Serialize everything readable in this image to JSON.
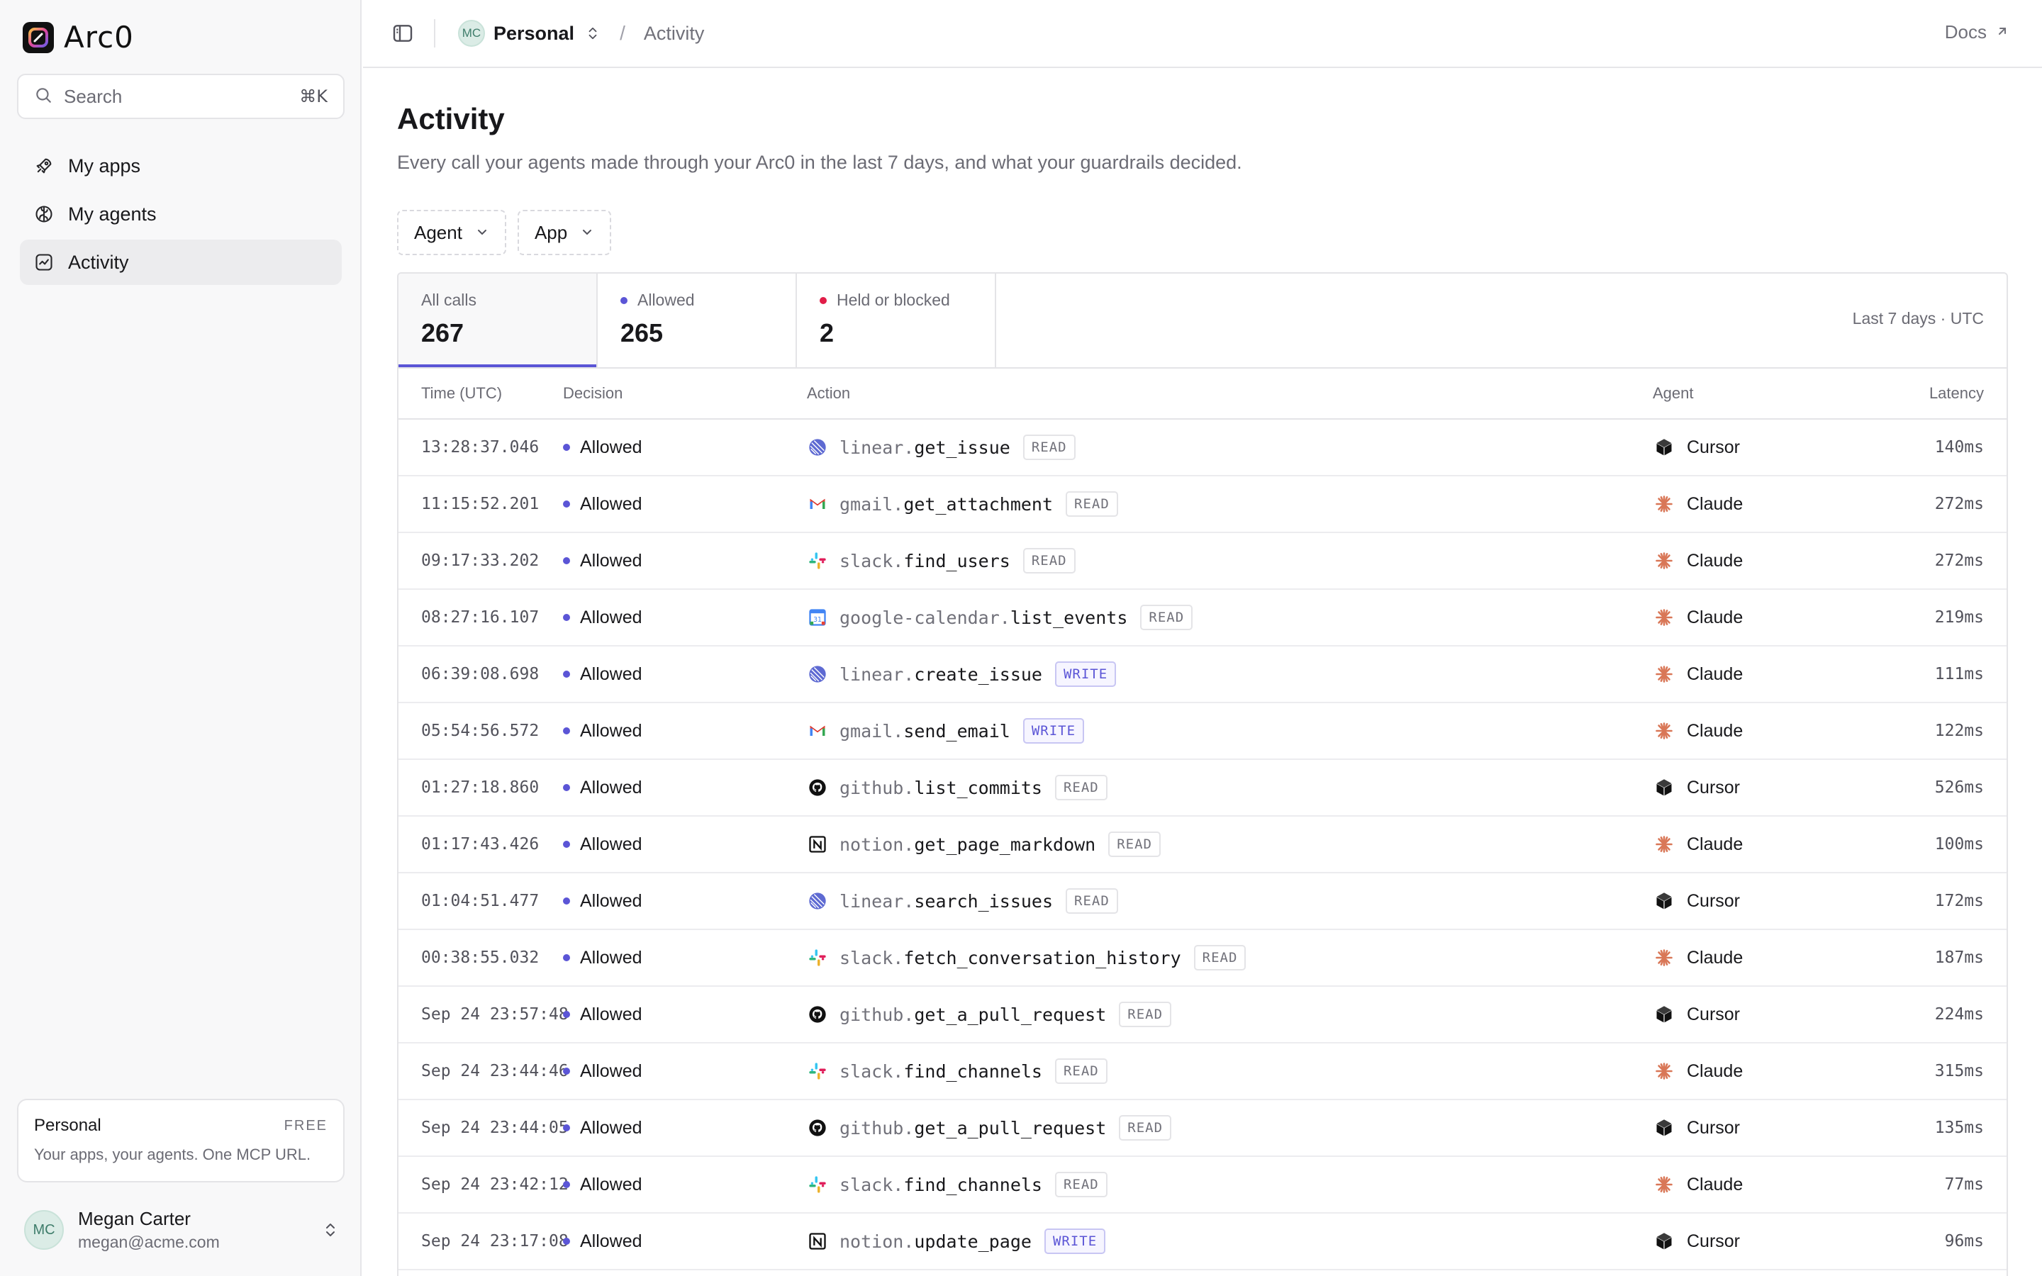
{
  "brand": {
    "name": "Arc0"
  },
  "search": {
    "label": "Search",
    "shortcut": "⌘K"
  },
  "nav": [
    {
      "label": "My apps",
      "icon": "rocket-icon"
    },
    {
      "label": "My agents",
      "icon": "brain-icon"
    },
    {
      "label": "Activity",
      "icon": "activity-chart-icon",
      "active": true
    }
  ],
  "plan": {
    "name": "Personal",
    "tier": "FREE",
    "description": "Your apps, your agents. One MCP URL."
  },
  "user": {
    "initials": "MC",
    "name": "Megan Carter",
    "email": "megan@acme.com"
  },
  "topbar": {
    "workspace_initials": "MC",
    "workspace": "Personal",
    "separator": "/",
    "crumb": "Activity",
    "docs": "Docs"
  },
  "page": {
    "title": "Activity",
    "subtitle": "Every call your agents made through your Arc0 in the last 7 days, and what your guardrails decided."
  },
  "filters": {
    "agent": "Agent",
    "app": "App"
  },
  "stats": {
    "all_label": "All calls",
    "all_value": "267",
    "allowed_label": "Allowed",
    "allowed_value": "265",
    "blocked_label": "Held or blocked",
    "blocked_value": "2",
    "range": "Last 7 days · UTC"
  },
  "colors": {
    "accent": "#5b55d6",
    "blocked": "#e11d48",
    "write_badge": "#5b55d6"
  },
  "table": {
    "headers": {
      "time": "Time (UTC)",
      "decision": "Decision",
      "action": "Action",
      "agent": "Agent",
      "latency": "Latency"
    },
    "rows": [
      {
        "time": "13:28:37.046",
        "decision": "Allowed",
        "app": "linear",
        "ns": "linear.",
        "fn": "get_issue",
        "access": "READ",
        "agent": "Cursor",
        "latency": "140ms"
      },
      {
        "time": "11:15:52.201",
        "decision": "Allowed",
        "app": "gmail",
        "ns": "gmail.",
        "fn": "get_attachment",
        "access": "READ",
        "agent": "Claude",
        "latency": "272ms"
      },
      {
        "time": "09:17:33.202",
        "decision": "Allowed",
        "app": "slack",
        "ns": "slack.",
        "fn": "find_users",
        "access": "READ",
        "agent": "Claude",
        "latency": "272ms"
      },
      {
        "time": "08:27:16.107",
        "decision": "Allowed",
        "app": "google-calendar",
        "ns": "google-calendar.",
        "fn": "list_events",
        "access": "READ",
        "agent": "Claude",
        "latency": "219ms"
      },
      {
        "time": "06:39:08.698",
        "decision": "Allowed",
        "app": "linear",
        "ns": "linear.",
        "fn": "create_issue",
        "access": "WRITE",
        "agent": "Claude",
        "latency": "111ms"
      },
      {
        "time": "05:54:56.572",
        "decision": "Allowed",
        "app": "gmail",
        "ns": "gmail.",
        "fn": "send_email",
        "access": "WRITE",
        "agent": "Claude",
        "latency": "122ms"
      },
      {
        "time": "01:27:18.860",
        "decision": "Allowed",
        "app": "github",
        "ns": "github.",
        "fn": "list_commits",
        "access": "READ",
        "agent": "Cursor",
        "latency": "526ms"
      },
      {
        "time": "01:17:43.426",
        "decision": "Allowed",
        "app": "notion",
        "ns": "notion.",
        "fn": "get_page_markdown",
        "access": "READ",
        "agent": "Claude",
        "latency": "100ms"
      },
      {
        "time": "01:04:51.477",
        "decision": "Allowed",
        "app": "linear",
        "ns": "linear.",
        "fn": "search_issues",
        "access": "READ",
        "agent": "Cursor",
        "latency": "172ms"
      },
      {
        "time": "00:38:55.032",
        "decision": "Allowed",
        "app": "slack",
        "ns": "slack.",
        "fn": "fetch_conversation_history",
        "access": "READ",
        "agent": "Claude",
        "latency": "187ms"
      },
      {
        "time": "Sep 24 23:57:48",
        "decision": "Allowed",
        "app": "github",
        "ns": "github.",
        "fn": "get_a_pull_request",
        "access": "READ",
        "agent": "Cursor",
        "latency": "224ms"
      },
      {
        "time": "Sep 24 23:44:46",
        "decision": "Allowed",
        "app": "slack",
        "ns": "slack.",
        "fn": "find_channels",
        "access": "READ",
        "agent": "Claude",
        "latency": "315ms"
      },
      {
        "time": "Sep 24 23:44:05",
        "decision": "Allowed",
        "app": "github",
        "ns": "github.",
        "fn": "get_a_pull_request",
        "access": "READ",
        "agent": "Cursor",
        "latency": "135ms"
      },
      {
        "time": "Sep 24 23:42:12",
        "decision": "Allowed",
        "app": "slack",
        "ns": "slack.",
        "fn": "find_channels",
        "access": "READ",
        "agent": "Claude",
        "latency": "77ms"
      },
      {
        "time": "Sep 24 23:17:08",
        "decision": "Allowed",
        "app": "notion",
        "ns": "notion.",
        "fn": "update_page",
        "access": "WRITE",
        "agent": "Cursor",
        "latency": "96ms"
      }
    ]
  }
}
